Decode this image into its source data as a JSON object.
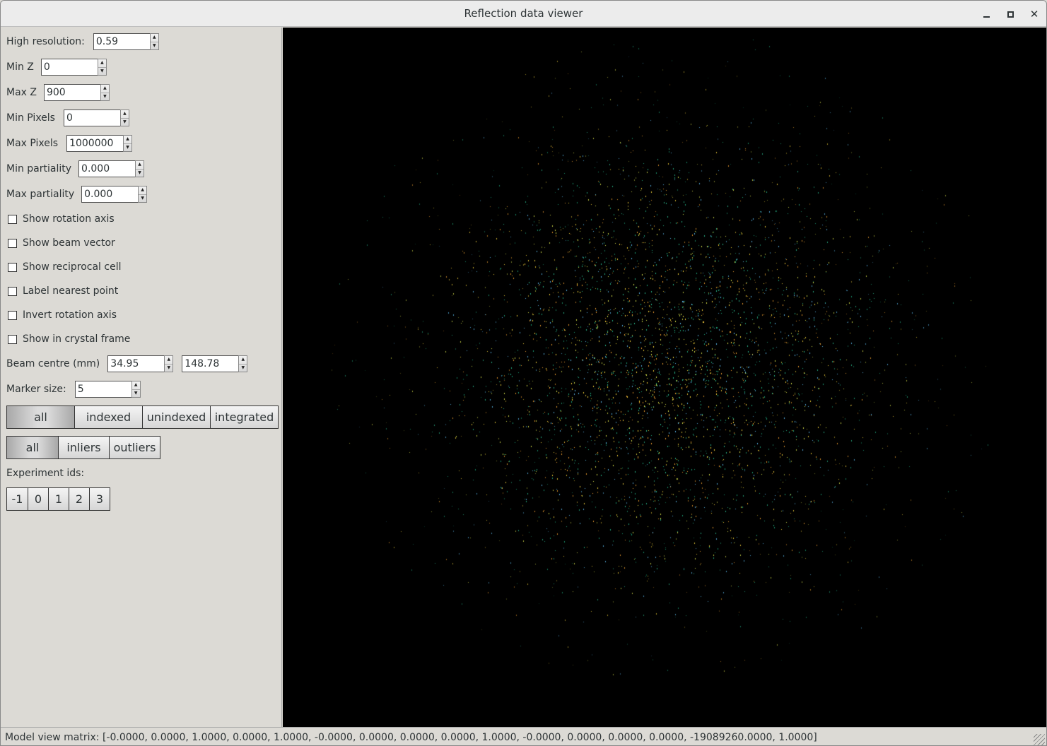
{
  "window": {
    "title": "Reflection data viewer",
    "controls": {
      "minimize": "minimize-icon",
      "maximize": "maximize-icon",
      "close": "close-icon"
    }
  },
  "panel": {
    "high_resolution": {
      "label": "High resolution:",
      "value": "0.59"
    },
    "min_z": {
      "label": "Min Z",
      "value": "0"
    },
    "max_z": {
      "label": "Max Z",
      "value": "900"
    },
    "min_pixels": {
      "label": "Min Pixels",
      "value": "0"
    },
    "max_pixels": {
      "label": "Max Pixels",
      "value": "1000000"
    },
    "min_partiality": {
      "label": "Min partiality",
      "value": "0.000"
    },
    "max_partiality": {
      "label": "Max partiality",
      "value": "0.000"
    },
    "checkboxes": [
      {
        "label": "Show rotation axis",
        "checked": false
      },
      {
        "label": "Show beam vector",
        "checked": false
      },
      {
        "label": "Show reciprocal cell",
        "checked": false
      },
      {
        "label": "Label nearest point",
        "checked": false
      },
      {
        "label": "Invert rotation axis",
        "checked": false
      },
      {
        "label": "Show in crystal frame",
        "checked": false
      }
    ],
    "beam_centre": {
      "label": "Beam centre (mm)",
      "x": "34.95",
      "y": "148.78"
    },
    "marker_size": {
      "label": "Marker size:",
      "value": "5"
    },
    "filter_index": {
      "options": [
        "all",
        "indexed",
        "unindexed",
        "integrated"
      ],
      "selected": "all"
    },
    "filter_outlier": {
      "options": [
        "all",
        "inliers",
        "outliers"
      ],
      "selected": "all"
    },
    "experiment_ids": {
      "label": "Experiment ids:",
      "options": [
        "-1",
        "0",
        "1",
        "2",
        "3"
      ]
    }
  },
  "viewer": {
    "background": "#000000",
    "point_colors": [
      "#f5d33a",
      "#f0a030",
      "#1fa37a",
      "#2bb58a",
      "#5ab4e6",
      "#d6e04a"
    ]
  },
  "status": {
    "text": "Model view matrix: [-0.0000, 0.0000, 1.0000, 0.0000, 1.0000, -0.0000, 0.0000, 0.0000, 0.0000, 1.0000, -0.0000, 0.0000, 0.0000, 0.0000, -19089260.0000, 1.0000]"
  }
}
